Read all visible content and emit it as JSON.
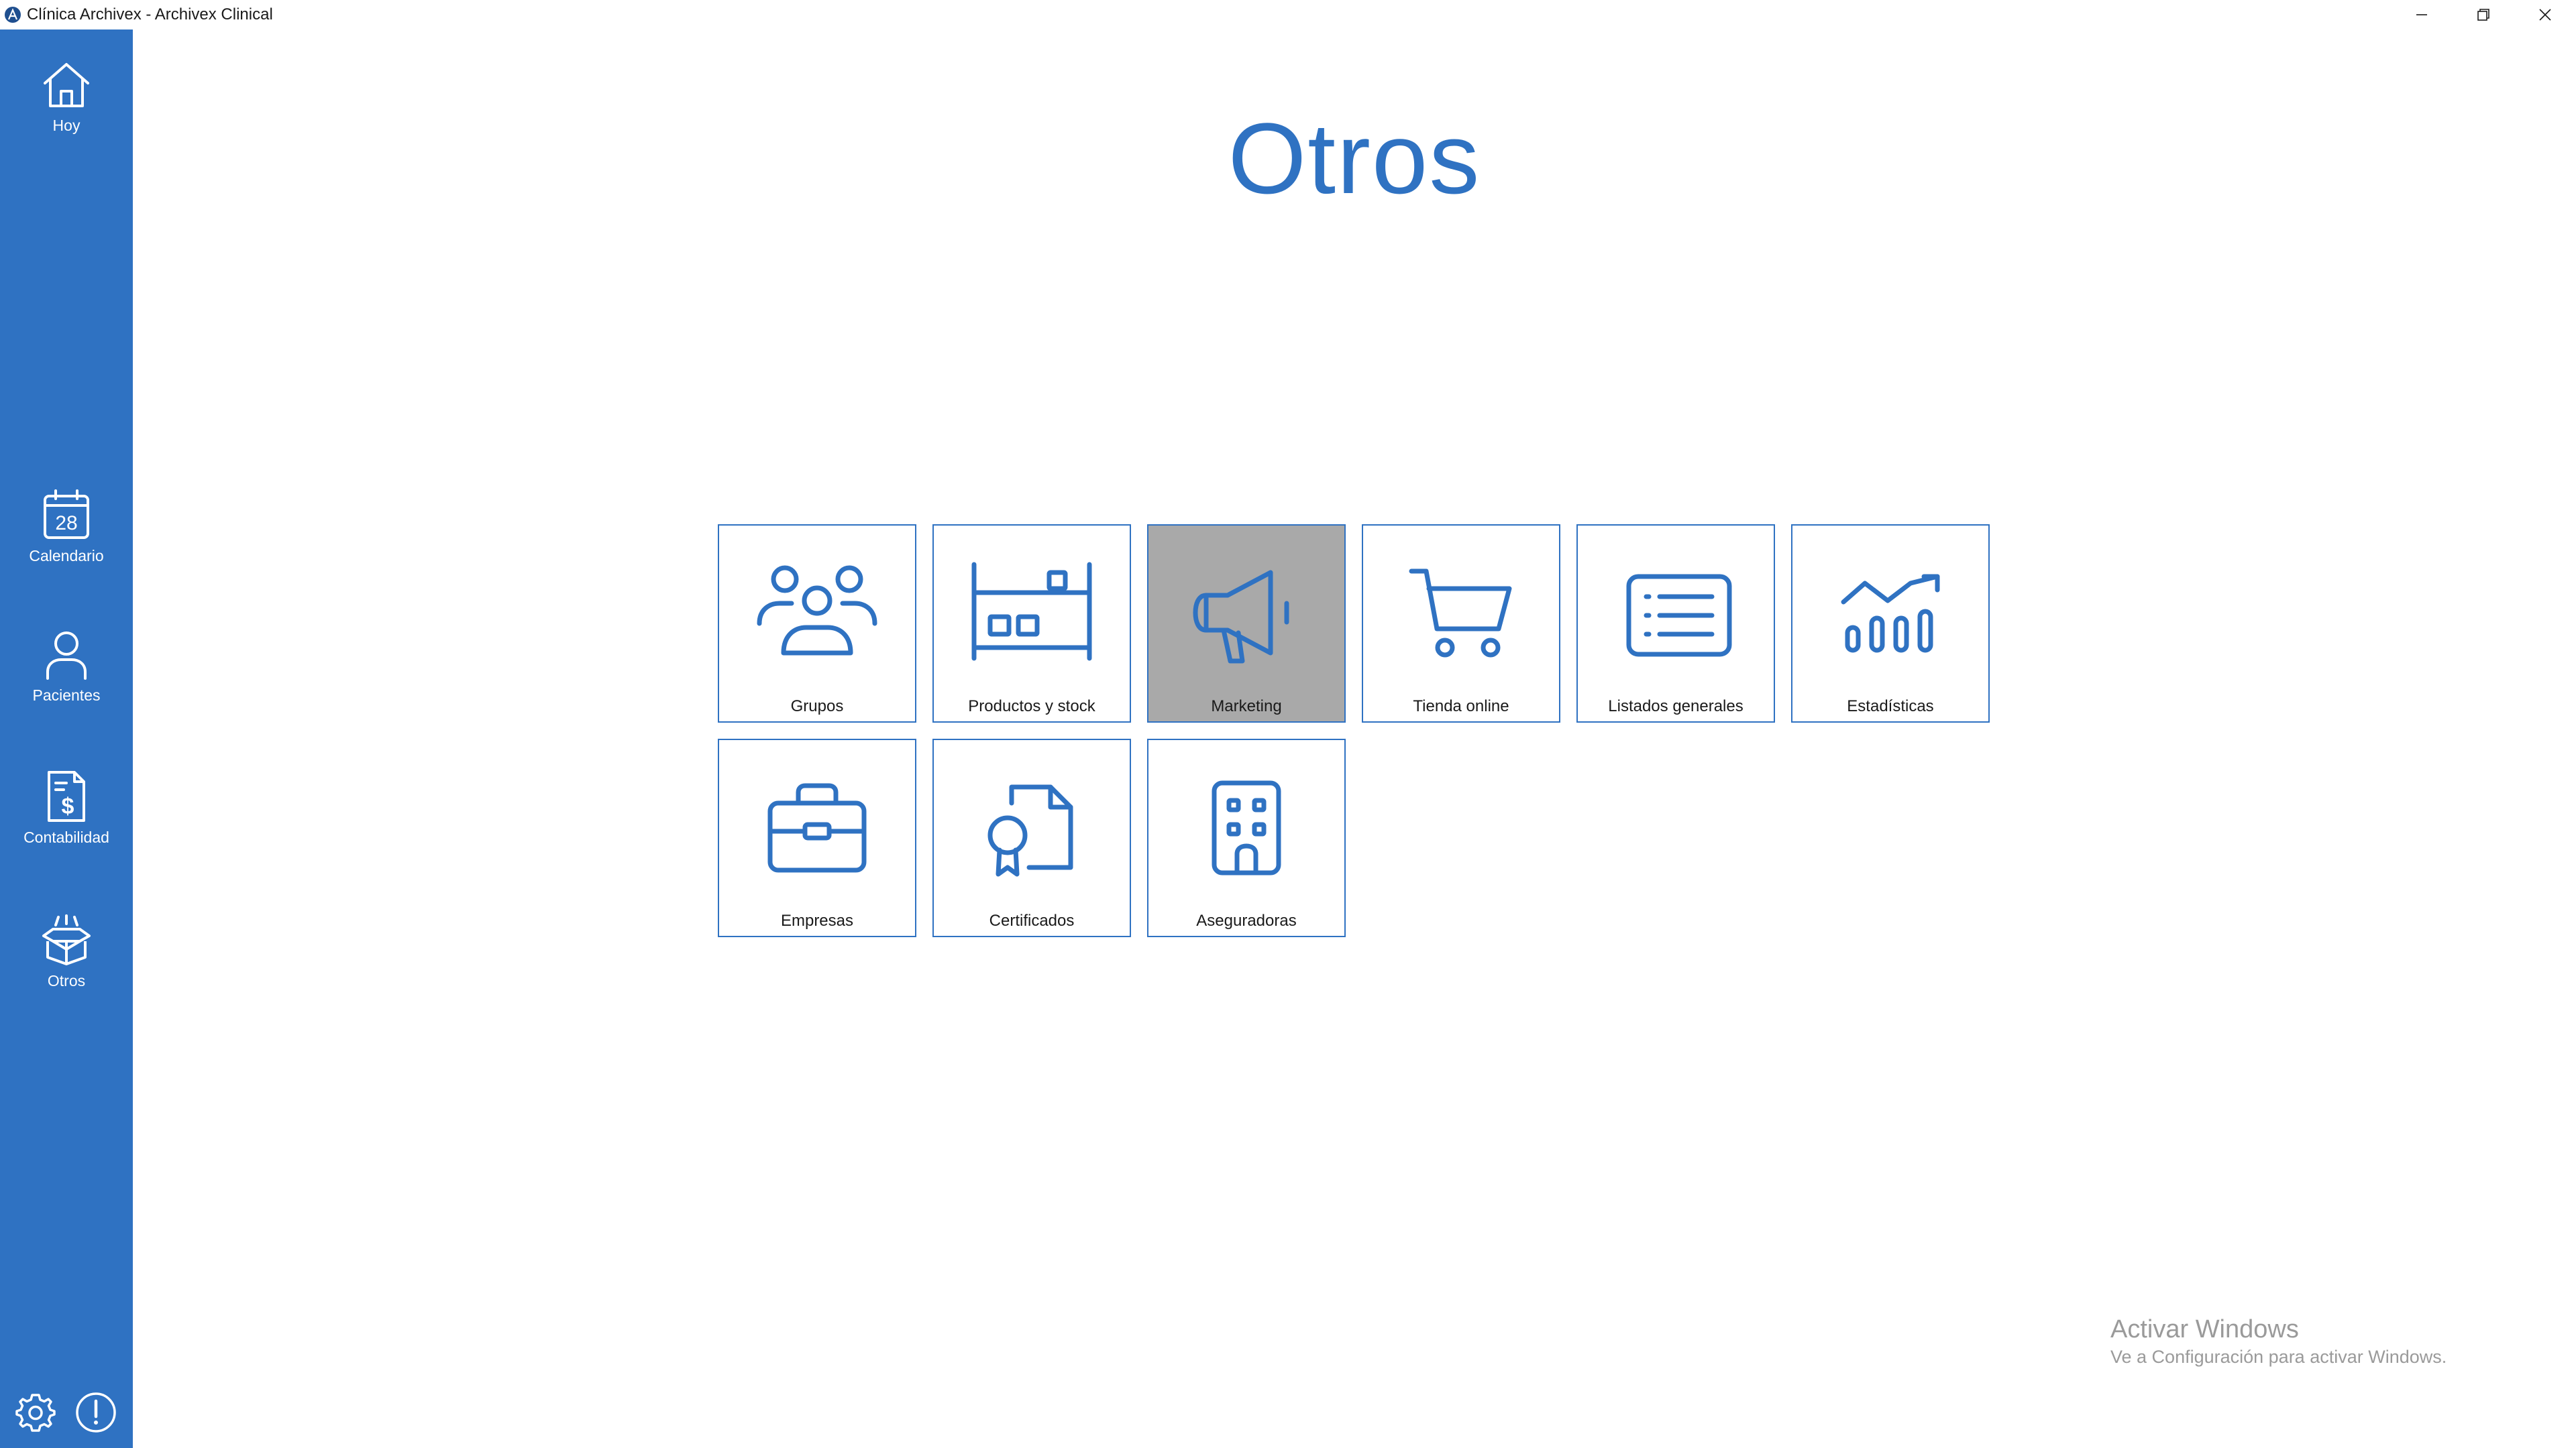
{
  "window": {
    "title": "Clínica Archivex - Archivex Clinical"
  },
  "sidebar": {
    "items": [
      {
        "label": "Hoy",
        "icon": "home-icon"
      },
      {
        "label": "Calendario",
        "icon": "calendar-icon",
        "day": "28"
      },
      {
        "label": "Pacientes",
        "icon": "person-icon"
      },
      {
        "label": "Contabilidad",
        "icon": "invoice-icon"
      },
      {
        "label": "Otros",
        "icon": "open-box-icon"
      }
    ],
    "bottom": [
      {
        "icon": "gear-icon"
      },
      {
        "icon": "alert-icon"
      }
    ]
  },
  "main": {
    "title": "Otros",
    "tiles": [
      {
        "label": "Grupos",
        "icon": "group-icon"
      },
      {
        "label": "Productos y stock",
        "icon": "shelf-icon"
      },
      {
        "label": "Marketing",
        "icon": "megaphone-icon",
        "selected": true
      },
      {
        "label": "Tienda online",
        "icon": "cart-icon"
      },
      {
        "label": "Listados generales",
        "icon": "list-icon"
      },
      {
        "label": "Estadísticas",
        "icon": "stats-icon"
      },
      {
        "label": "Empresas",
        "icon": "briefcase-icon"
      },
      {
        "label": "Certificados",
        "icon": "certificate-icon"
      },
      {
        "label": "Aseguradoras",
        "icon": "building-icon"
      }
    ]
  },
  "watermark": {
    "title": "Activar Windows",
    "subtitle": "Ve a Configuración para activar Windows."
  },
  "colors": {
    "accent": "#2f72c2",
    "selected_tile": "#a9a9a9"
  }
}
